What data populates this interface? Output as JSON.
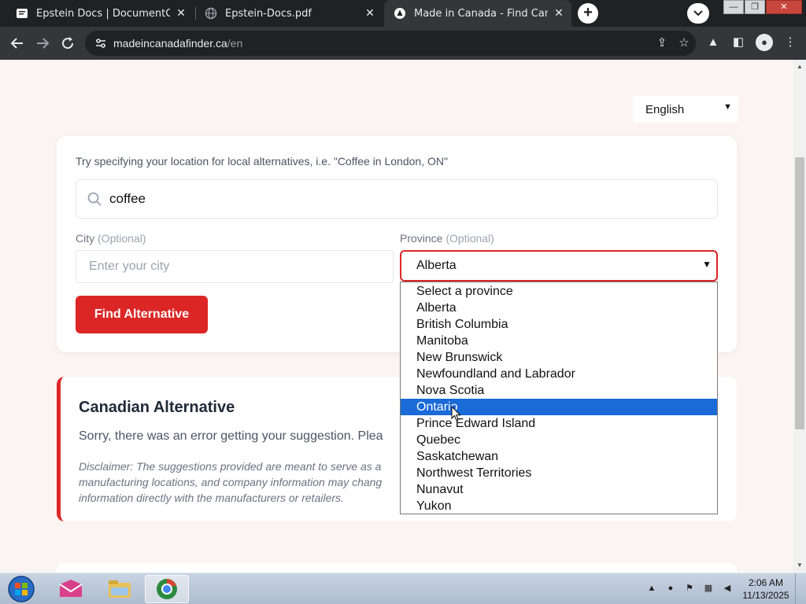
{
  "browser": {
    "tabs": [
      {
        "title": "Epstein Docs | DocumentCloud",
        "icon": "documentcloud-icon"
      },
      {
        "title": "Epstein-Docs.pdf",
        "icon": "globe-icon"
      },
      {
        "title": "Made in Canada - Find Canadian",
        "icon": "madeincanada-icon"
      }
    ],
    "active_tab": 2,
    "url_host": "madeincanadafinder.ca",
    "url_path": "/en"
  },
  "page": {
    "language": "English",
    "search": {
      "hint": "Try specifying your location for local alternatives, i.e. \"Coffee in London, ON\"",
      "query": "coffee"
    },
    "city": {
      "label": "City",
      "optional": "(Optional)",
      "placeholder": "Enter your city"
    },
    "province": {
      "label": "Province",
      "optional": "(Optional)",
      "selected": "Alberta",
      "highlighted": "Ontario",
      "options": [
        "Select a province",
        "Alberta",
        "British Columbia",
        "Manitoba",
        "New Brunswick",
        "Newfoundland and Labrador",
        "Nova Scotia",
        "Ontario",
        "Prince Edward Island",
        "Quebec",
        "Saskatchewan",
        "Northwest Territories",
        "Nunavut",
        "Yukon"
      ]
    },
    "find_button": "Find Alternative",
    "result": {
      "title": "Canadian Alternative",
      "error": "Sorry, there was an error getting your suggestion. Plea",
      "disclaimer": "Disclaimer: The suggestions provided are meant to serve as a manufacturing locations, and company information may chang information directly with the manufacturers or retailers."
    }
  },
  "taskbar": {
    "apps": [
      "mail-app-icon",
      "file-explorer-icon",
      "chrome-icon"
    ],
    "time": "2:06 AM",
    "date": "11/13/2025"
  },
  "colors": {
    "accent": "#dc2626",
    "selection": "#1a6ad8",
    "page_bg": "#fbf4f3"
  }
}
